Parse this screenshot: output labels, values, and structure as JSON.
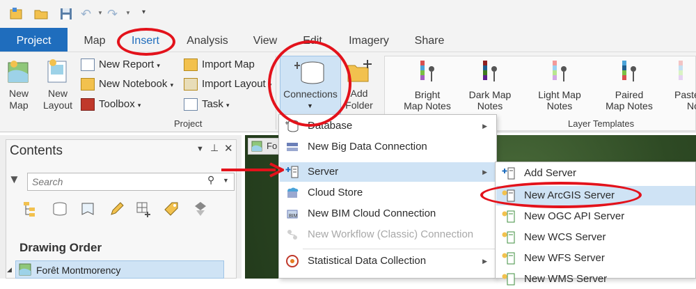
{
  "tabs": [
    {
      "label": "Project"
    },
    {
      "label": "Map"
    },
    {
      "label": "Insert"
    },
    {
      "label": "Analysis"
    },
    {
      "label": "View"
    },
    {
      "label": "Edit"
    },
    {
      "label": "Imagery"
    },
    {
      "label": "Share"
    }
  ],
  "ribbon": {
    "new_map_1": "New",
    "new_map_2": "Map",
    "new_layout_1": "New",
    "new_layout_2": "Layout",
    "new_report": "New Report",
    "new_notebook": "New Notebook",
    "toolbox": "Toolbox",
    "import_map": "Import Map",
    "import_layout": "Import Layout",
    "task": "Task",
    "project_group": "Project",
    "connections": "Connections",
    "add_folder_1": "Add",
    "add_folder_2": "Folder",
    "layer_templates_group": "Layer Templates",
    "templates": [
      {
        "l1": "Bright",
        "l2": "Map Notes"
      },
      {
        "l1": "Dark Map",
        "l2": "Notes"
      },
      {
        "l1": "Light Map",
        "l2": "Notes"
      },
      {
        "l1": "Paired",
        "l2": "Map Notes"
      },
      {
        "l1": "Paste",
        "l2": "No"
      }
    ]
  },
  "contents": {
    "title": "Contents",
    "search_placeholder": "Search",
    "drawing_order": "Drawing Order",
    "layer_name": "Forêt Montmorency"
  },
  "map_tab_label": "Fo",
  "connections_menu": [
    {
      "label": "Database"
    },
    {
      "label": "New Big Data Connection"
    },
    {
      "label": "Server"
    },
    {
      "label": "Cloud Store"
    },
    {
      "label": "New BIM Cloud Connection"
    },
    {
      "label": "New Workflow (Classic) Connection"
    },
    {
      "label": "Statistical Data Collection"
    }
  ],
  "server_submenu": [
    {
      "label": "Add Server"
    },
    {
      "label": "New ArcGIS Server"
    },
    {
      "label": "New OGC API Server"
    },
    {
      "label": "New WCS Server"
    },
    {
      "label": "New WFS Server"
    },
    {
      "label": "New WMS Server"
    }
  ],
  "colors": {
    "accent": "#1f6dbd",
    "annotation": "#e3121b",
    "highlight": "#cfe3f5"
  }
}
